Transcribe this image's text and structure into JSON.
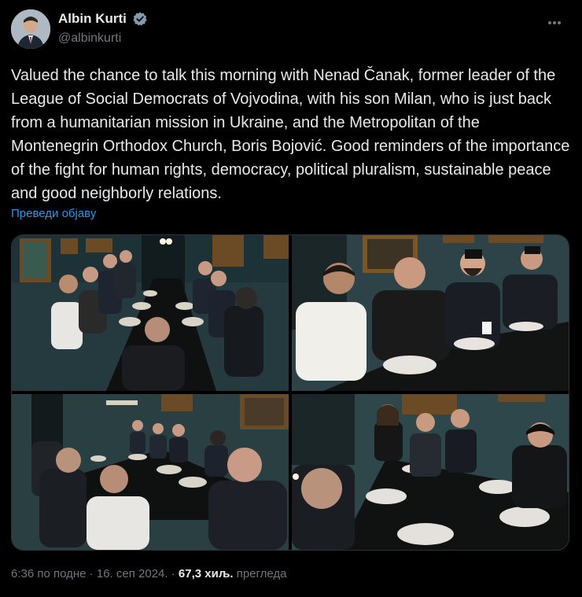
{
  "author": {
    "display_name": "Albin Kurti",
    "handle": "@albinkurti"
  },
  "tweet": {
    "text": "Valued the chance to talk this morning with Nenad Čanak, former leader of the League of Social Democrats of Vojvodina, with his son Milan, who is just back from a humanitarian mission in Ukraine, and the Metropolitan of the Montenegrin Orthodox Church, Boris Bojović. Good reminders of the importance of the fight for human rights, democracy, political pluralism, sustainable peace and good neighborly relations.",
    "translate_label": "Преведи објаву"
  },
  "meta": {
    "time": "6:36 по подне",
    "sep1": " · ",
    "date": "16. сеп 2024.",
    "sep2": " · ",
    "views_count": "67,3 хиљ.",
    "views_label": " прегледа"
  },
  "colors": {
    "background": "#000000",
    "text": "#e7e9ea",
    "muted": "#71767b",
    "link": "#1d9bf0",
    "verified": "#829aab"
  },
  "icons": [
    "verified-badge-icon",
    "more-options-icon"
  ]
}
